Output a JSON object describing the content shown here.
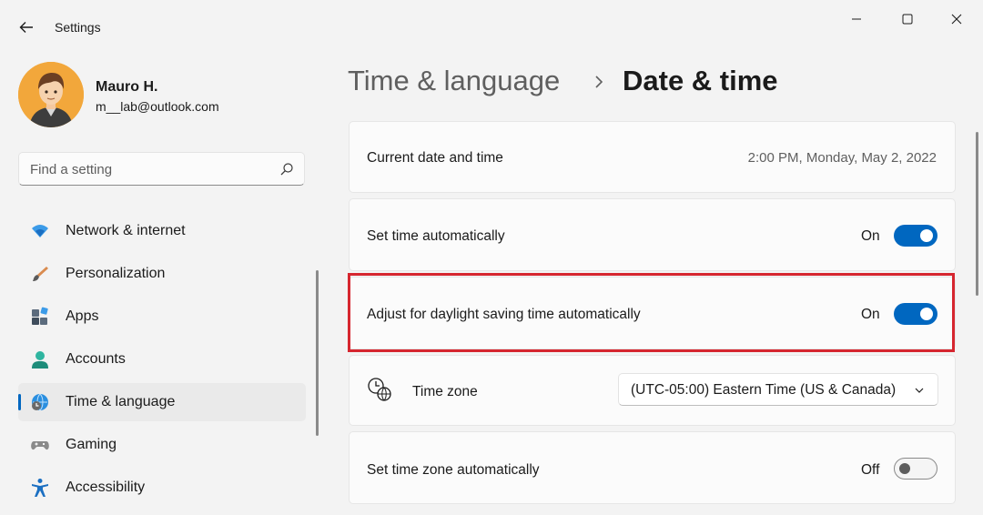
{
  "window": {
    "title": "Settings",
    "controls": {
      "minimize": "minimize-icon",
      "maximize": "maximize-icon",
      "close": "close-icon"
    }
  },
  "profile": {
    "name": "Mauro H.",
    "email": "m__lab@outlook.com"
  },
  "search": {
    "placeholder": "Find a setting"
  },
  "sidebar": {
    "items": [
      {
        "label": "Network & internet",
        "icon": "wifi-icon",
        "selected": false
      },
      {
        "label": "Personalization",
        "icon": "brush-icon",
        "selected": false
      },
      {
        "label": "Apps",
        "icon": "apps-icon",
        "selected": false
      },
      {
        "label": "Accounts",
        "icon": "person-icon",
        "selected": false
      },
      {
        "label": "Time & language",
        "icon": "globe-clock-icon",
        "selected": true
      },
      {
        "label": "Gaming",
        "icon": "gamepad-icon",
        "selected": false
      },
      {
        "label": "Accessibility",
        "icon": "accessibility-icon",
        "selected": false
      }
    ]
  },
  "header": {
    "parent": "Time & language",
    "current": "Date & time"
  },
  "settings": {
    "current_datetime": {
      "label": "Current date and time",
      "value": "2:00 PM, Monday, May 2, 2022"
    },
    "set_time_auto": {
      "label": "Set time automatically",
      "state": "On",
      "on": true
    },
    "daylight_saving": {
      "label": "Adjust for daylight saving time automatically",
      "state": "On",
      "on": true
    },
    "time_zone": {
      "label": "Time zone",
      "value": "(UTC-05:00) Eastern Time (US & Canada)"
    },
    "set_tz_auto": {
      "label": "Set time zone automatically",
      "state": "Off",
      "on": false
    }
  },
  "colors": {
    "accent": "#0067c0",
    "highlight": "#d6262f",
    "background": "#f3f3f3",
    "card": "#fbfbfb"
  }
}
